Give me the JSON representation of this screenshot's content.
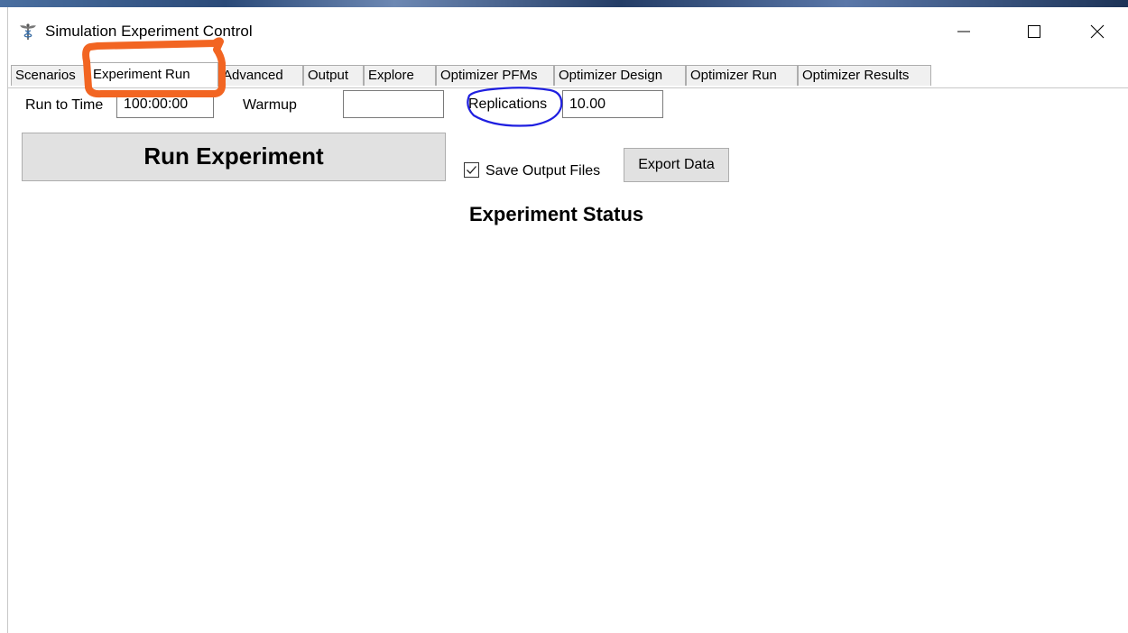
{
  "window": {
    "title": "Simulation Experiment Control",
    "app_icon": "caduceus-icon"
  },
  "tabs": [
    {
      "label": "Scenarios",
      "active": false
    },
    {
      "label": "Experiment Run",
      "active": true
    },
    {
      "label": "Advanced",
      "active": false
    },
    {
      "label": "Output",
      "active": false
    },
    {
      "label": "Explore",
      "active": false
    },
    {
      "label": "Optimizer PFMs",
      "active": false
    },
    {
      "label": "Optimizer Design",
      "active": false
    },
    {
      "label": "Optimizer Run",
      "active": false
    },
    {
      "label": "Optimizer Results",
      "active": false
    }
  ],
  "settings": {
    "run_to_time_label": "Run to Time",
    "run_to_time_value": "100:00:00",
    "warmup_label": "Warmup",
    "warmup_value": "",
    "replications_label": "Replications",
    "replications_value": "10.00"
  },
  "actions": {
    "run_label": "Run Experiment",
    "save_output_label": "Save Output Files",
    "save_output_checked": true,
    "export_label": "Export Data"
  },
  "status": {
    "title": "Experiment Status"
  },
  "annotations": {
    "tab_highlight_color": "#f26522",
    "replications_circle_color": "#1f1fe0"
  }
}
